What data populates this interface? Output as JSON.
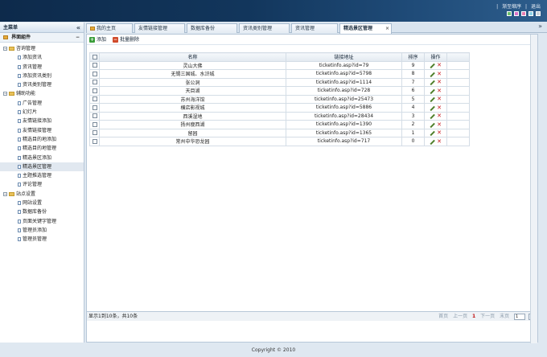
{
  "header": {
    "links": [
      "|",
      "渐至缩序",
      "|",
      "退出"
    ],
    "swatches": [
      "#6cc16c",
      "#d874c8",
      "#e37bb0",
      "#8fd3e8",
      "#c9d0d8"
    ]
  },
  "sidebar": {
    "title": "主菜单",
    "collapse": "«",
    "section": "界面組件",
    "section_toggle": "−",
    "items": [
      {
        "label": "咨询管理",
        "level": 1
      },
      {
        "label": "添加资讯",
        "level": 2
      },
      {
        "label": "资讯管理",
        "level": 2
      },
      {
        "label": "添加资讯类别",
        "level": 2
      },
      {
        "label": "资讯类别管理",
        "level": 2
      },
      {
        "label": "辅助功能",
        "level": 1
      },
      {
        "label": "广告管理",
        "level": 2
      },
      {
        "label": "幻灯片",
        "level": 2
      },
      {
        "label": "友情链接添加",
        "level": 2
      },
      {
        "label": "友情链接管理",
        "level": 2
      },
      {
        "label": "精选目的地添加",
        "level": 2
      },
      {
        "label": "精选目的地管理",
        "level": 2
      },
      {
        "label": "精选景区添加",
        "level": 2
      },
      {
        "label": "精选景区管理",
        "level": 2,
        "selected": true
      },
      {
        "label": "主题推选管理",
        "level": 2
      },
      {
        "label": "评论管理",
        "level": 2
      },
      {
        "label": "站点设置",
        "level": 1
      },
      {
        "label": "网站设置",
        "level": 2
      },
      {
        "label": "数据库备份",
        "level": 2
      },
      {
        "label": "页面关键字管理",
        "level": 2
      },
      {
        "label": "管理员添加",
        "level": 2
      },
      {
        "label": "管理员管理",
        "level": 2
      }
    ]
  },
  "tabs": {
    "items": [
      {
        "label": "我的主页"
      },
      {
        "label": "友情链接管理"
      },
      {
        "label": "数据库备份"
      },
      {
        "label": "资讯类别管理"
      },
      {
        "label": "资讯管理"
      },
      {
        "label": "精选景区管理",
        "active": true
      }
    ],
    "close": "×",
    "scroll": "»"
  },
  "toolbar": {
    "add_label": "添加",
    "batch_delete_label": "批量删除"
  },
  "table": {
    "headers": {
      "name": "名称",
      "url": "链接地址",
      "sort": "排序",
      "ops": "操作"
    },
    "rows": [
      {
        "name": "灵山大佛",
        "url": "ticketinfo.asp?id=79",
        "sort": "9"
      },
      {
        "name": "无锡三国城、水浒城",
        "url": "ticketinfo.asp?id=5798",
        "sort": "8"
      },
      {
        "name": "张公洞",
        "url": "ticketinfo.asp?id=1114",
        "sort": "7"
      },
      {
        "name": "天目湖",
        "url": "ticketinfo.asp?id=728",
        "sort": "6"
      },
      {
        "name": "苏州海洋馆",
        "url": "ticketinfo.asp?id=25473",
        "sort": "5"
      },
      {
        "name": "横店影视城",
        "url": "ticketinfo.asp?id=5886",
        "sort": "4"
      },
      {
        "name": "西溪湿地",
        "url": "ticketinfo.asp?id=28434",
        "sort": "3"
      },
      {
        "name": "扬州瘦西湖",
        "url": "ticketinfo.asp?id=1390",
        "sort": "2"
      },
      {
        "name": "留园",
        "url": "ticketinfo.asp?id=1365",
        "sort": "1"
      },
      {
        "name": "常州中华恐龙园",
        "url": "ticketinfo.asp?id=717",
        "sort": "0"
      }
    ]
  },
  "pager": {
    "summary": "显示1到10条，共10条",
    "first": "首页",
    "prev": "上一页",
    "current": "1",
    "next": "下一页",
    "last": "末页",
    "page_input": "1"
  },
  "footer": {
    "copyright": "Copyright © 2010"
  }
}
